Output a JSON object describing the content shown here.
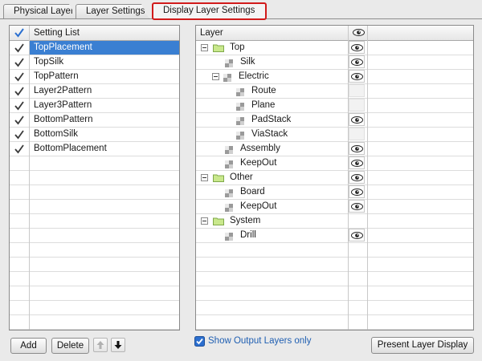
{
  "tabs": [
    {
      "label": "Physical Layer"
    },
    {
      "label": "Layer Settings"
    },
    {
      "label": "Display Layer Settings",
      "active": true
    }
  ],
  "setting_list": {
    "header": "Setting List",
    "items": [
      {
        "label": "TopPlacement",
        "checked": true,
        "selected": true
      },
      {
        "label": "TopSilk",
        "checked": true
      },
      {
        "label": "TopPattern",
        "checked": true
      },
      {
        "label": "Layer2Pattern",
        "checked": true
      },
      {
        "label": "Layer3Pattern",
        "checked": true
      },
      {
        "label": "BottomPattern",
        "checked": true
      },
      {
        "label": "BottomSilk",
        "checked": true
      },
      {
        "label": "BottomPlacement",
        "checked": true
      }
    ],
    "buttons": {
      "add": "Add",
      "delete": "Delete"
    }
  },
  "layer_tree": {
    "header": "Layer",
    "rows": [
      {
        "label": "Top",
        "kind": "group",
        "depth": 0,
        "visible": true
      },
      {
        "label": "Silk",
        "kind": "layer",
        "depth": 1,
        "visible": true
      },
      {
        "label": "Electric",
        "kind": "subgroup",
        "depth": 1,
        "visible": true
      },
      {
        "label": "Route",
        "kind": "layer",
        "depth": 2,
        "visible": false
      },
      {
        "label": "Plane",
        "kind": "layer",
        "depth": 2,
        "visible": false
      },
      {
        "label": "PadStack",
        "kind": "layer",
        "depth": 2,
        "visible": true
      },
      {
        "label": "ViaStack",
        "kind": "layer",
        "depth": 2,
        "visible": false
      },
      {
        "label": "Assembly",
        "kind": "layer",
        "depth": 1,
        "visible": true
      },
      {
        "label": "KeepOut",
        "kind": "layer",
        "depth": 1,
        "visible": true
      },
      {
        "label": "Other",
        "kind": "group",
        "depth": 0,
        "visible": true
      },
      {
        "label": "Board",
        "kind": "layer",
        "depth": 1,
        "visible": true
      },
      {
        "label": "KeepOut",
        "kind": "layer",
        "depth": 1,
        "visible": true
      },
      {
        "label": "System",
        "kind": "group",
        "depth": 0,
        "visible": false
      },
      {
        "label": "Drill",
        "kind": "layer",
        "depth": 1,
        "visible": true
      }
    ]
  },
  "show_output_layers": {
    "label": "Show Output Layers only",
    "checked": true
  },
  "present_button": "Present Layer Display",
  "colors": {
    "selection": "#3a7fd2",
    "highlight_border": "#d11a1a",
    "link_text": "#1f5fb2"
  }
}
